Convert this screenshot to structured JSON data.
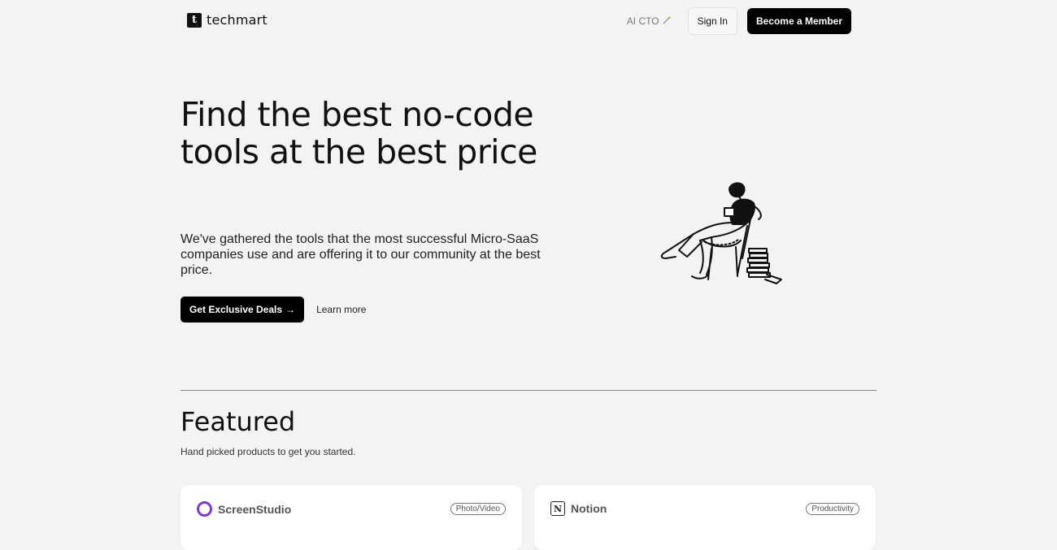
{
  "nav": {
    "logo_mark": "t",
    "logo_text": "techmart",
    "ai_cto": "AI CTO",
    "ai_cto_icon": "magic-wand-icon",
    "sign_in": "Sign In",
    "become_member": "Become a Member"
  },
  "hero": {
    "title": "Find the best no-code tools at the best price",
    "subtitle": "We've gathered the tools that the most successful Micro-SaaS companies use and are offering it to our community at the best price.",
    "cta_primary": "Get Exclusive Deals",
    "cta_arrow": "→",
    "cta_secondary": "Learn more",
    "illustration": "person-reading-in-chair-illustration"
  },
  "featured": {
    "title": "Featured",
    "subtitle": "Hand picked products to get you started.",
    "cards": [
      {
        "name": "ScreenStudio",
        "tag": "Photo/Video",
        "icon": "screenstudio-icon"
      },
      {
        "name": "Notion",
        "tag": "Productivity",
        "icon": "notion-icon"
      }
    ]
  },
  "colors": {
    "background": "#f3f3f3",
    "primary_button": "#000000",
    "screenstudio_accent": "#7a3bd6"
  }
}
